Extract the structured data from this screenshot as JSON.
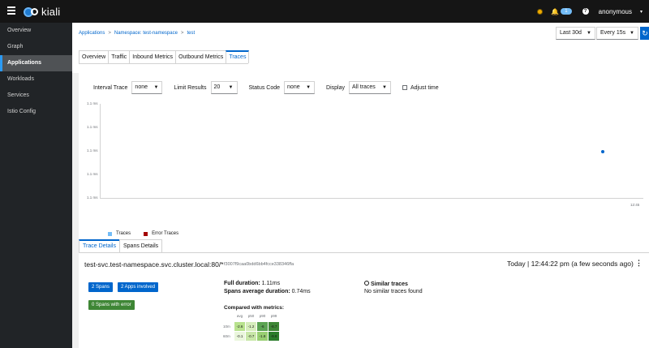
{
  "topbar": {
    "brand": "kiali",
    "notification_count": "1",
    "help_icon": "?",
    "user": "anonymous",
    "icons": [
      "hamburger-icon",
      "kiali-logo",
      "status-icon",
      "bell-icon",
      "help-icon",
      "chevron-down-icon"
    ]
  },
  "sidebar": {
    "items": [
      {
        "label": "Overview"
      },
      {
        "label": "Graph"
      },
      {
        "label": "Applications",
        "active": true
      },
      {
        "label": "Workloads"
      },
      {
        "label": "Services"
      },
      {
        "label": "Istio Config"
      }
    ]
  },
  "breadcrumb": {
    "root": "Applications",
    "namespace": "Namespace: test-namespace",
    "app": "test",
    "sep": ">"
  },
  "controls": {
    "duration": "Last 30d",
    "refresh": "Every 15s",
    "refresh_icon": "refresh-icon"
  },
  "tabs": [
    "Overview",
    "Traffic",
    "Inbound Metrics",
    "Outbound Metrics",
    "Traces"
  ],
  "active_tab": "Traces",
  "filters": {
    "interval_label": "Interval Trace",
    "interval_value": "none",
    "limit_label": "Limit Results",
    "limit_value": "20",
    "status_label": "Status Code",
    "status_value": "none",
    "display_label": "Display",
    "display_value": "All traces",
    "adjust_label": "Adjust time"
  },
  "chart_data": {
    "type": "scatter",
    "y_tick_labels": [
      "1.1 ms",
      "1.1 ms",
      "1.1 ms",
      "1.1 ms",
      "1.1 ms"
    ],
    "x_tick_labels": [
      "12:45"
    ],
    "series": [
      {
        "name": "Traces",
        "color": "#73bcf7",
        "points": [
          {
            "x": "12:44:22",
            "y": 1.11
          }
        ]
      },
      {
        "name": "Error Traces",
        "color": "#a30000",
        "points": []
      }
    ],
    "grid": false,
    "legend": "bottom-left"
  },
  "details": {
    "tabs": [
      "Trace Details",
      "Spans Details"
    ],
    "active_tab": "Trace Details",
    "trace_name": "test-svc.test-namespace.svc.cluster.local:80/*",
    "trace_id": "f3007f9caa0bdd6bb4fcce338346ffa",
    "time": "Today  |  12:44:22 pm (a few seconds ago)",
    "kebab": "⋮",
    "spans_badge": "2 Spans",
    "apps_badge": "2 Apps involved",
    "errors_badge": "0 Spans with error",
    "full_duration_label": "Full duration:",
    "full_duration_value": "1.11ms",
    "spans_avg_label": "Spans average duration:",
    "spans_avg_value": "0.74ms",
    "similar_title": "Similar traces",
    "similar_text": "No similar traces found",
    "compared_title": "Compared with metrics:",
    "heatmap": {
      "columns": [
        "avg",
        "p50",
        "p90",
        "p99"
      ],
      "rows": [
        {
          "label": "10m",
          "values": [
            "-2.6",
            "-1.2",
            "-6",
            "-8.7"
          ]
        },
        {
          "label": "60m",
          "values": [
            "-0.1",
            "-0.7",
            "-1.8",
            "-9.8"
          ]
        }
      ],
      "colors": [
        [
          "#b8e28e",
          "#d6edbc",
          "#5ba352",
          "#3e8635"
        ],
        [
          "#eaf6dc",
          "#c8e7a8",
          "#98cf72",
          "#2b7c2b"
        ]
      ]
    }
  }
}
